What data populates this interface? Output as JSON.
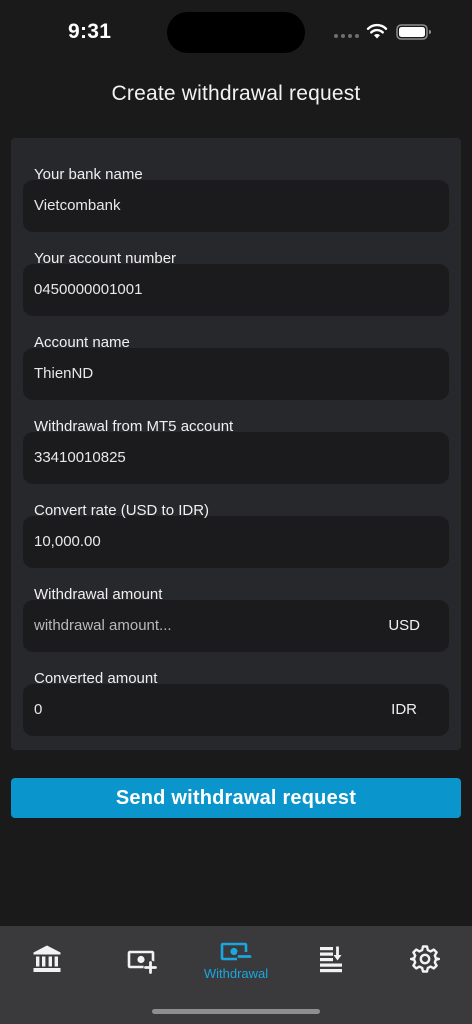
{
  "status_bar": {
    "time": "9:31"
  },
  "header": {
    "title": "Create withdrawal request"
  },
  "form": {
    "fields": [
      {
        "label": "Your bank name",
        "value": "Vietcombank"
      },
      {
        "label": "Your account number",
        "value": "0450000001001"
      },
      {
        "label": "Account name",
        "value": "ThienND"
      },
      {
        "label": "Withdrawal from MT5 account",
        "value": "33410010825"
      },
      {
        "label": "Convert rate (USD to IDR)",
        "value": "10,000.00"
      },
      {
        "label": "Withdrawal amount",
        "placeholder": "withdrawal amount...",
        "suffix": "USD"
      },
      {
        "label": "Converted amount",
        "value": "0",
        "suffix": "IDR"
      }
    ]
  },
  "submit": {
    "label": "Send withdrawal request"
  },
  "tab_bar": {
    "active_color": "#1aa6df",
    "inactive_color": "#f2f2f2",
    "tabs": [
      {
        "icon": "bank-icon",
        "label": ""
      },
      {
        "icon": "deposit-icon",
        "label": ""
      },
      {
        "icon": "withdrawal-icon",
        "label": "Withdrawal",
        "active": true
      },
      {
        "icon": "transfer-icon",
        "label": ""
      },
      {
        "icon": "gear-icon",
        "label": ""
      }
    ]
  }
}
